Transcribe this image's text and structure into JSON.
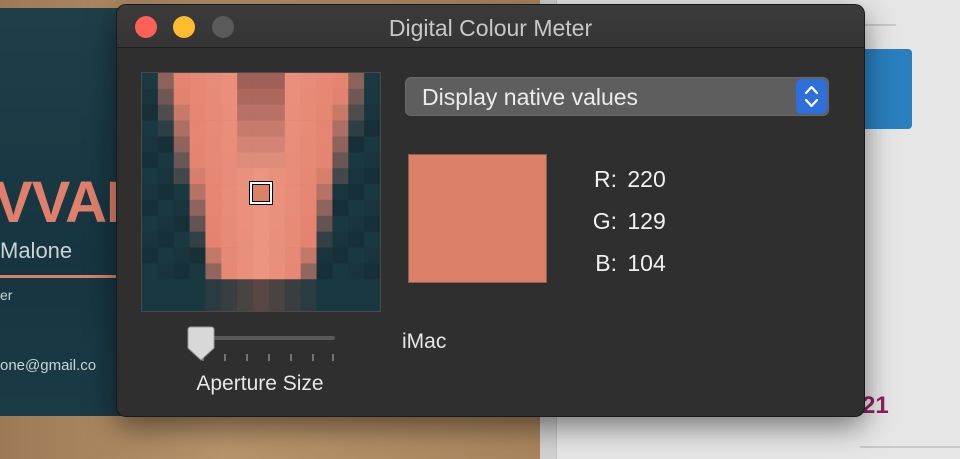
{
  "background": {
    "card_big_text": "VVAH",
    "card_name": "Malone",
    "card_role": "er",
    "card_email": "one@gmail.co",
    "right_number": "21"
  },
  "window": {
    "title": "Digital Colour Meter",
    "display_mode": "Display native values",
    "display_name": "iMac",
    "aperture_label": "Aperture Size",
    "aperture_level": 0,
    "swatch_color": "#dc8168",
    "values": {
      "r_label": "R:",
      "r": "220",
      "g_label": "G:",
      "g": "129",
      "b_label": "B:",
      "b": "104"
    }
  },
  "colors": {
    "close": "#fe5f57",
    "minimize": "#febc2e",
    "zoom": "#5a5a5a",
    "accent": "#2f6fdc"
  },
  "icons": [
    "close-button",
    "minimize-button",
    "zoom-button",
    "popup-stepper-icon",
    "slider-knob-icon"
  ]
}
